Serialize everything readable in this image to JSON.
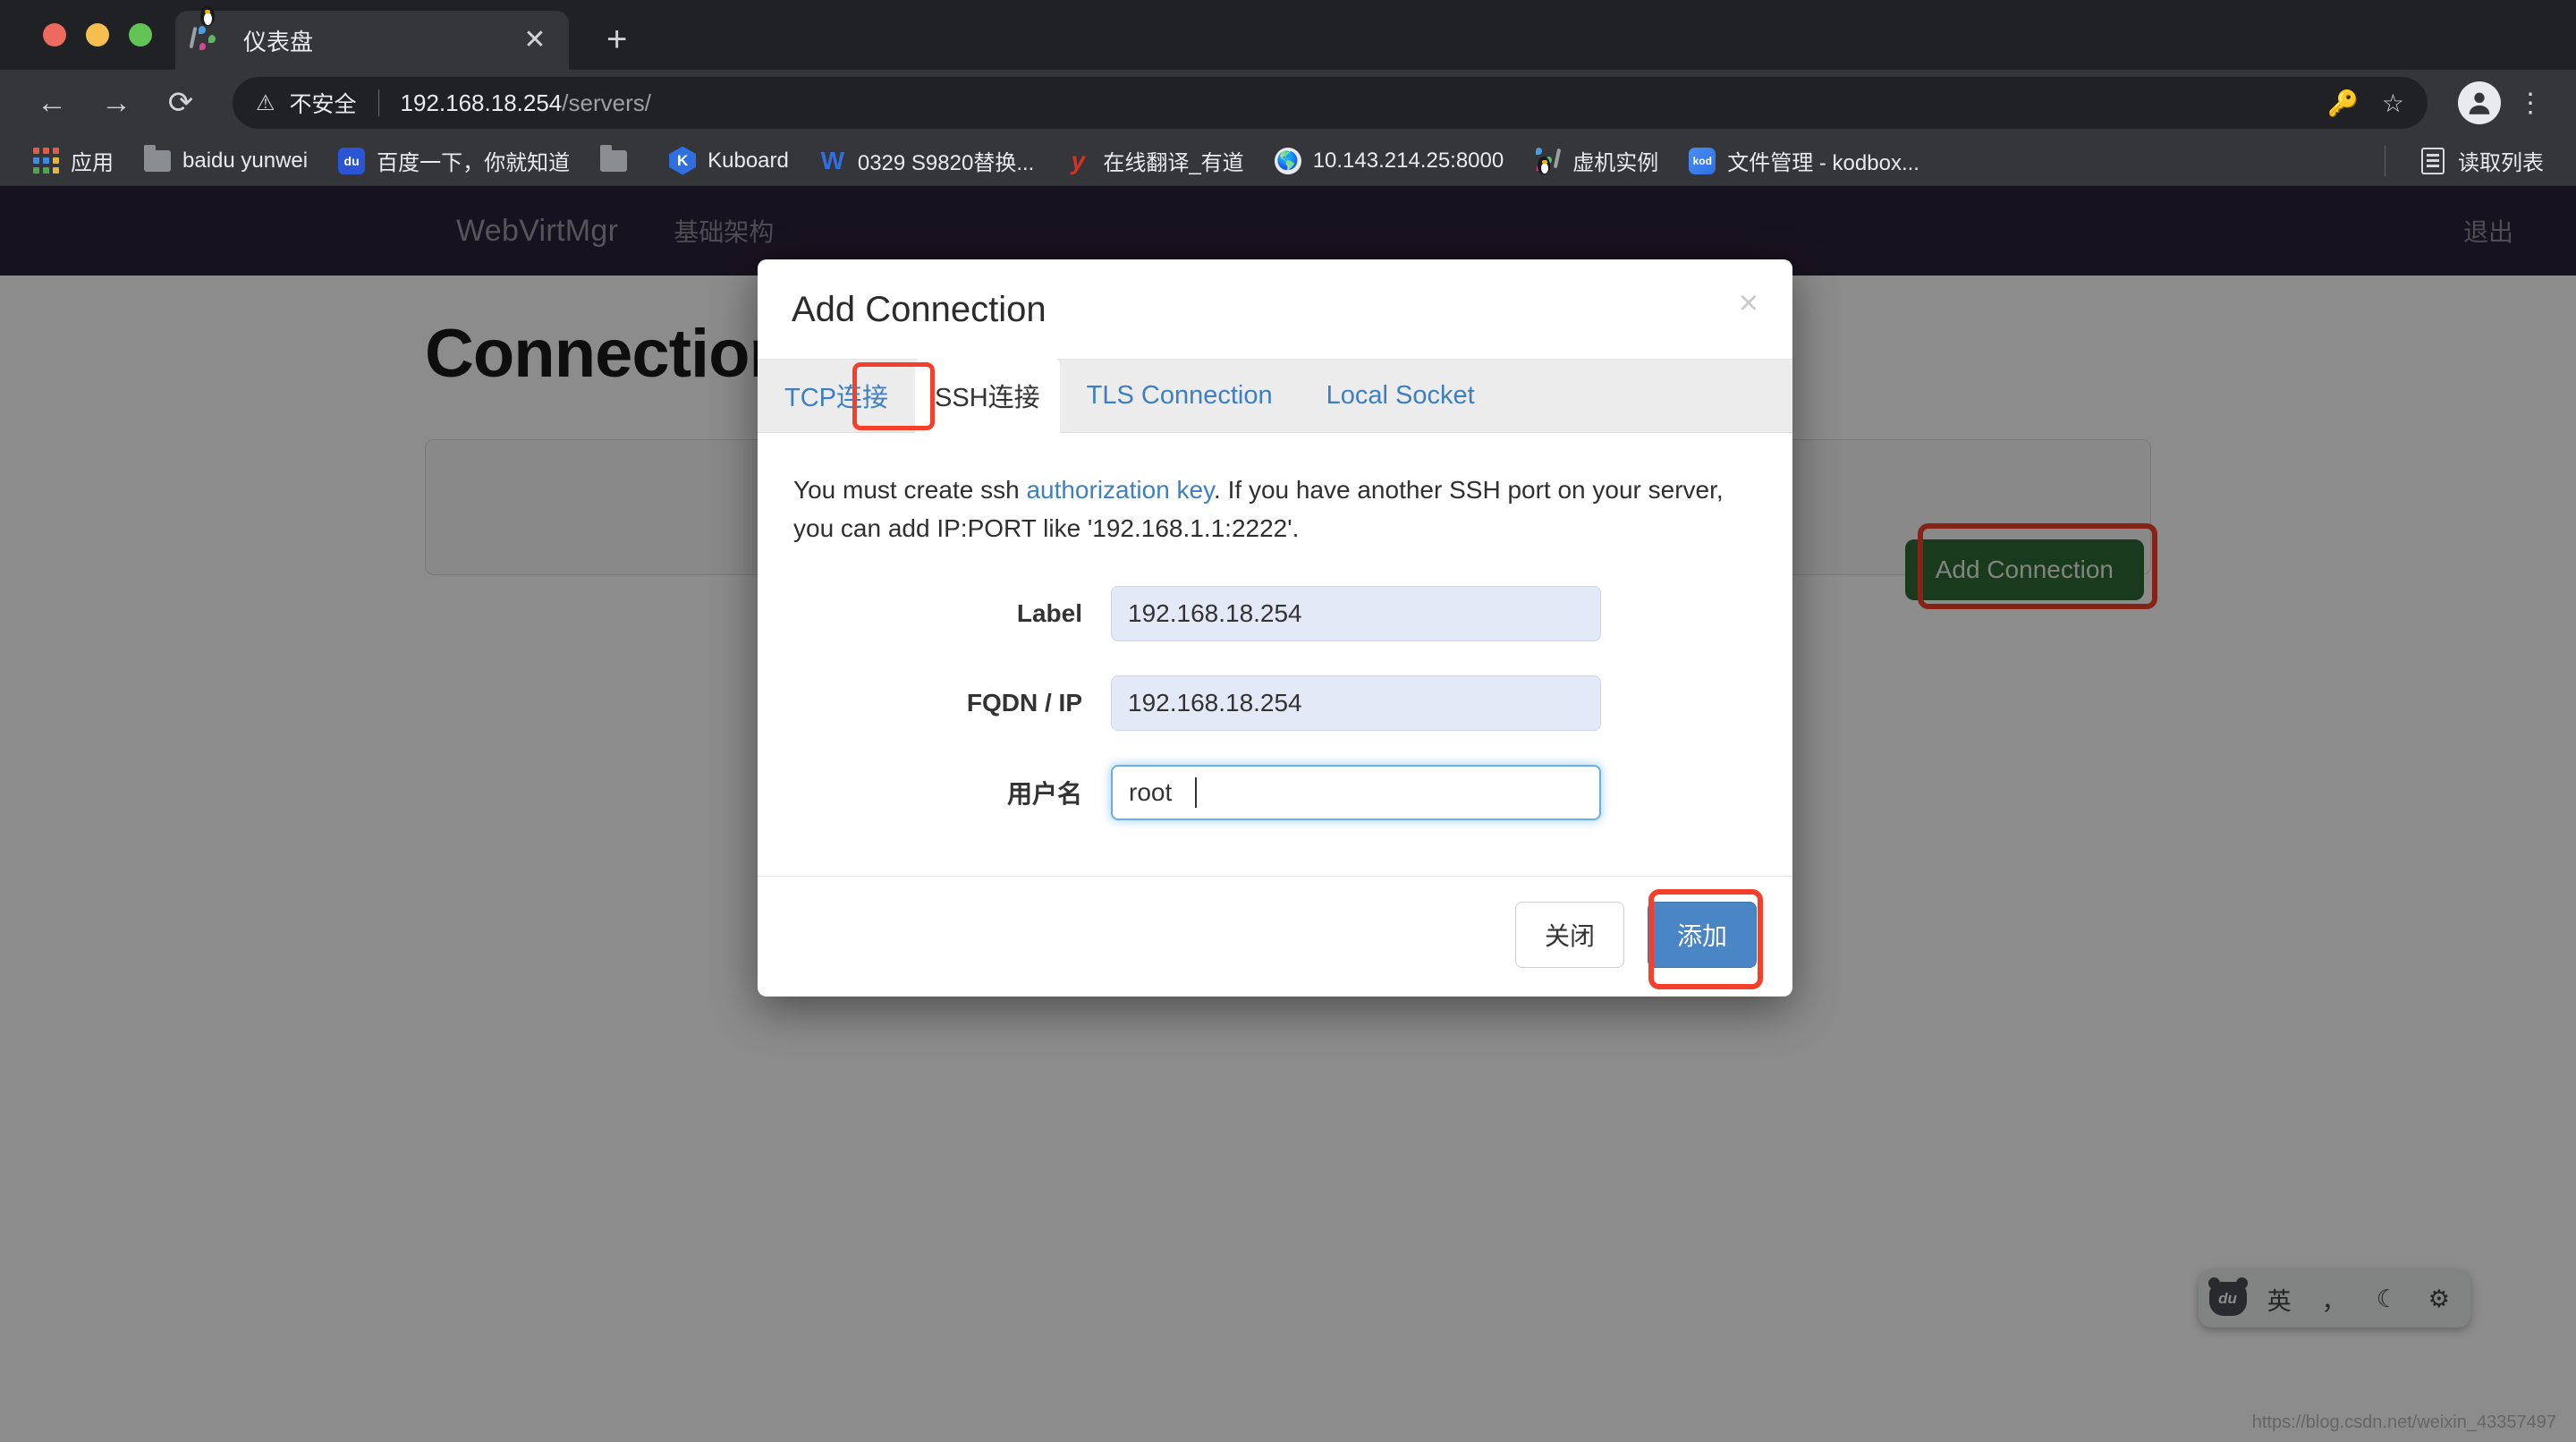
{
  "browser": {
    "tab": {
      "title": "仪表盘",
      "favicon": "penguin-webvirtmgr-favicon",
      "close_label": "✕"
    },
    "new_tab_label": "+",
    "nav": {
      "back": "←",
      "forward": "→",
      "reload": "⟳"
    },
    "omnibox": {
      "security_icon": "warning-triangle-icon",
      "security_label": "不安全",
      "url_host": "192.168.18.254",
      "url_path": "/servers/"
    },
    "toolbar_icons": [
      "key-icon",
      "star-icon",
      "profile-avatar-icon",
      "kebab-menu-icon"
    ],
    "bookmarks": [
      {
        "icon": "apps-grid-icon",
        "label": "应用"
      },
      {
        "icon": "folder-icon",
        "label": "baidu yunwei"
      },
      {
        "icon": "baidu-icon",
        "label": "百度一下，你就知道"
      },
      {
        "icon": "folder-icon",
        "label": ""
      },
      {
        "icon": "kuboard-icon",
        "label": "Kuboard"
      },
      {
        "icon": "w-icon",
        "label": "0329 S9820替换..."
      },
      {
        "icon": "youdao-icon",
        "label": "在线翻译_有道"
      },
      {
        "icon": "globe-icon",
        "label": "10.143.214.25:8000"
      },
      {
        "icon": "penguin-icon",
        "label": "虚机实例"
      },
      {
        "icon": "kodbox-icon",
        "label": "文件管理 - kodbox..."
      }
    ],
    "reading_list": {
      "icon": "reading-list-icon",
      "label": "读取列表"
    }
  },
  "page": {
    "navbar": {
      "brand": "WebVirtMgr",
      "links": [
        "基础架构"
      ],
      "logout": "退出"
    },
    "title": "Connection",
    "add_connection_button": "Add Connection"
  },
  "modal": {
    "title": "Add Connection",
    "close_label": "×",
    "tabs": [
      {
        "label": "TCP连接",
        "active": false
      },
      {
        "label": "SSH连接",
        "active": true
      },
      {
        "label": "TLS Connection",
        "active": false
      },
      {
        "label": "Local Socket",
        "active": false
      }
    ],
    "help": {
      "prefix": "You must create ssh ",
      "link": "authorization key",
      "suffix": ". If you have another SSH port on your server, you can add IP:PORT like '192.168.1.1:2222'."
    },
    "fields": [
      {
        "label": "Label",
        "value": "192.168.18.254",
        "focused": false
      },
      {
        "label": "FQDN / IP",
        "value": "192.168.18.254",
        "focused": false
      },
      {
        "label": "用户名",
        "value": "root",
        "focused": true
      }
    ],
    "footer": {
      "close_button": "关闭",
      "submit_button": "添加"
    }
  },
  "ime": {
    "logo": "du",
    "mode": "英",
    "punctuation": "，",
    "moon": "☾",
    "settings": "gear-icon"
  },
  "watermark": "https://blog.csdn.net/weixin_43357497",
  "colors": {
    "chrome_bg": "#35363a",
    "tabstrip_bg": "#202124",
    "navbar_bg": "#2b2239",
    "accent_link": "#3d7fc1",
    "primary_button": "#4a86c5",
    "add_connection_button": "#2f6b33",
    "highlight_box": "#f4402a"
  }
}
